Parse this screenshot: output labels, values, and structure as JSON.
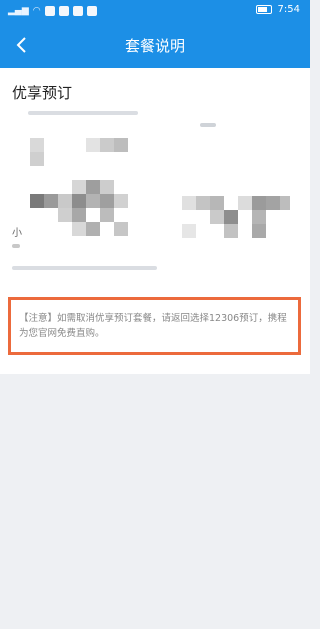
{
  "status_bar": {
    "time": "7:54",
    "left_icons": [
      "signal-icon",
      "wifi-icon",
      "notification-icons"
    ],
    "battery_icon": "battery-icon"
  },
  "nav": {
    "back_icon": "chevron-left-icon",
    "title": "套餐说明"
  },
  "content": {
    "section_title": "优享预订",
    "fragment_label": "小"
  },
  "note": {
    "text": "【注意】如需取消优享预订套餐，请返回选择12306预订，携程为您官网免费直购。"
  },
  "colors": {
    "brand_blue": "#1c8fe6",
    "highlight_orange": "#ec6a3c",
    "page_background": "#eef0f3"
  }
}
